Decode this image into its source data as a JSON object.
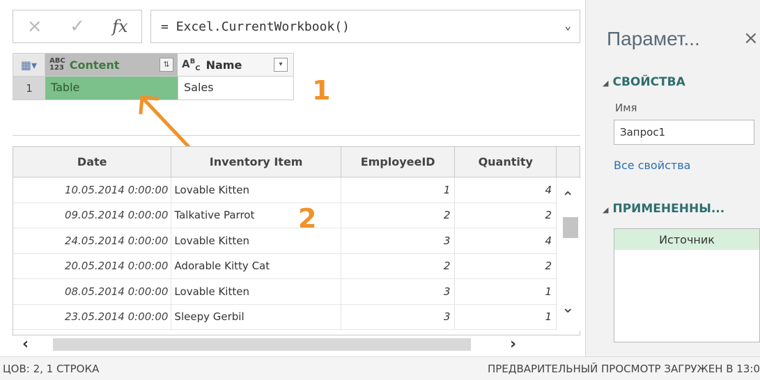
{
  "formula_bar": {
    "cancel_icon": "×",
    "confirm_icon": "✓",
    "fx_label": "fx",
    "formula": "= Excel.CurrentWorkbook()"
  },
  "top_table": {
    "content_type": "ABC\n123",
    "content_header": "Content",
    "name_type": "A^B_C",
    "name_header": "Name",
    "row_index": "1",
    "content_value": "Table",
    "name_value": "Sales"
  },
  "annotations": {
    "label1": "1",
    "label2": "2",
    "arrow_color": "#f0922a"
  },
  "grid": {
    "columns": [
      "Date",
      "Inventory Item",
      "EmployeeID",
      "Quantity"
    ],
    "rows": [
      [
        "10.05.2014 0:00:00",
        "Lovable Kitten",
        "1",
        "4"
      ],
      [
        "09.05.2014 0:00:00",
        "Talkative Parrot",
        "2",
        "2"
      ],
      [
        "24.05.2014 0:00:00",
        "Lovable Kitten",
        "3",
        "4"
      ],
      [
        "20.05.2014 0:00:00",
        "Adorable Kitty Cat",
        "2",
        "2"
      ],
      [
        "08.05.2014 0:00:00",
        "Lovable Kitten",
        "3",
        "1"
      ],
      [
        "23.05.2014 0:00:00",
        "Sleepy Gerbil",
        "3",
        "1"
      ]
    ]
  },
  "status": {
    "left": "ЦОВ: 2, 1 СТРОКА",
    "right": "ПРЕДВАРИТЕЛЬНЫЙ ПРОСМОТР ЗАГРУЖЕН В 13:0"
  },
  "panel": {
    "title": "Парамет...",
    "close_icon": "×",
    "section_properties": "СВОЙСТВА",
    "name_label": "Имя",
    "name_value": "Запрос1",
    "all_properties_link": "Все свойства",
    "section_applied": "ПРИМЕНЕННЫ...",
    "steps": [
      "Источник"
    ]
  }
}
